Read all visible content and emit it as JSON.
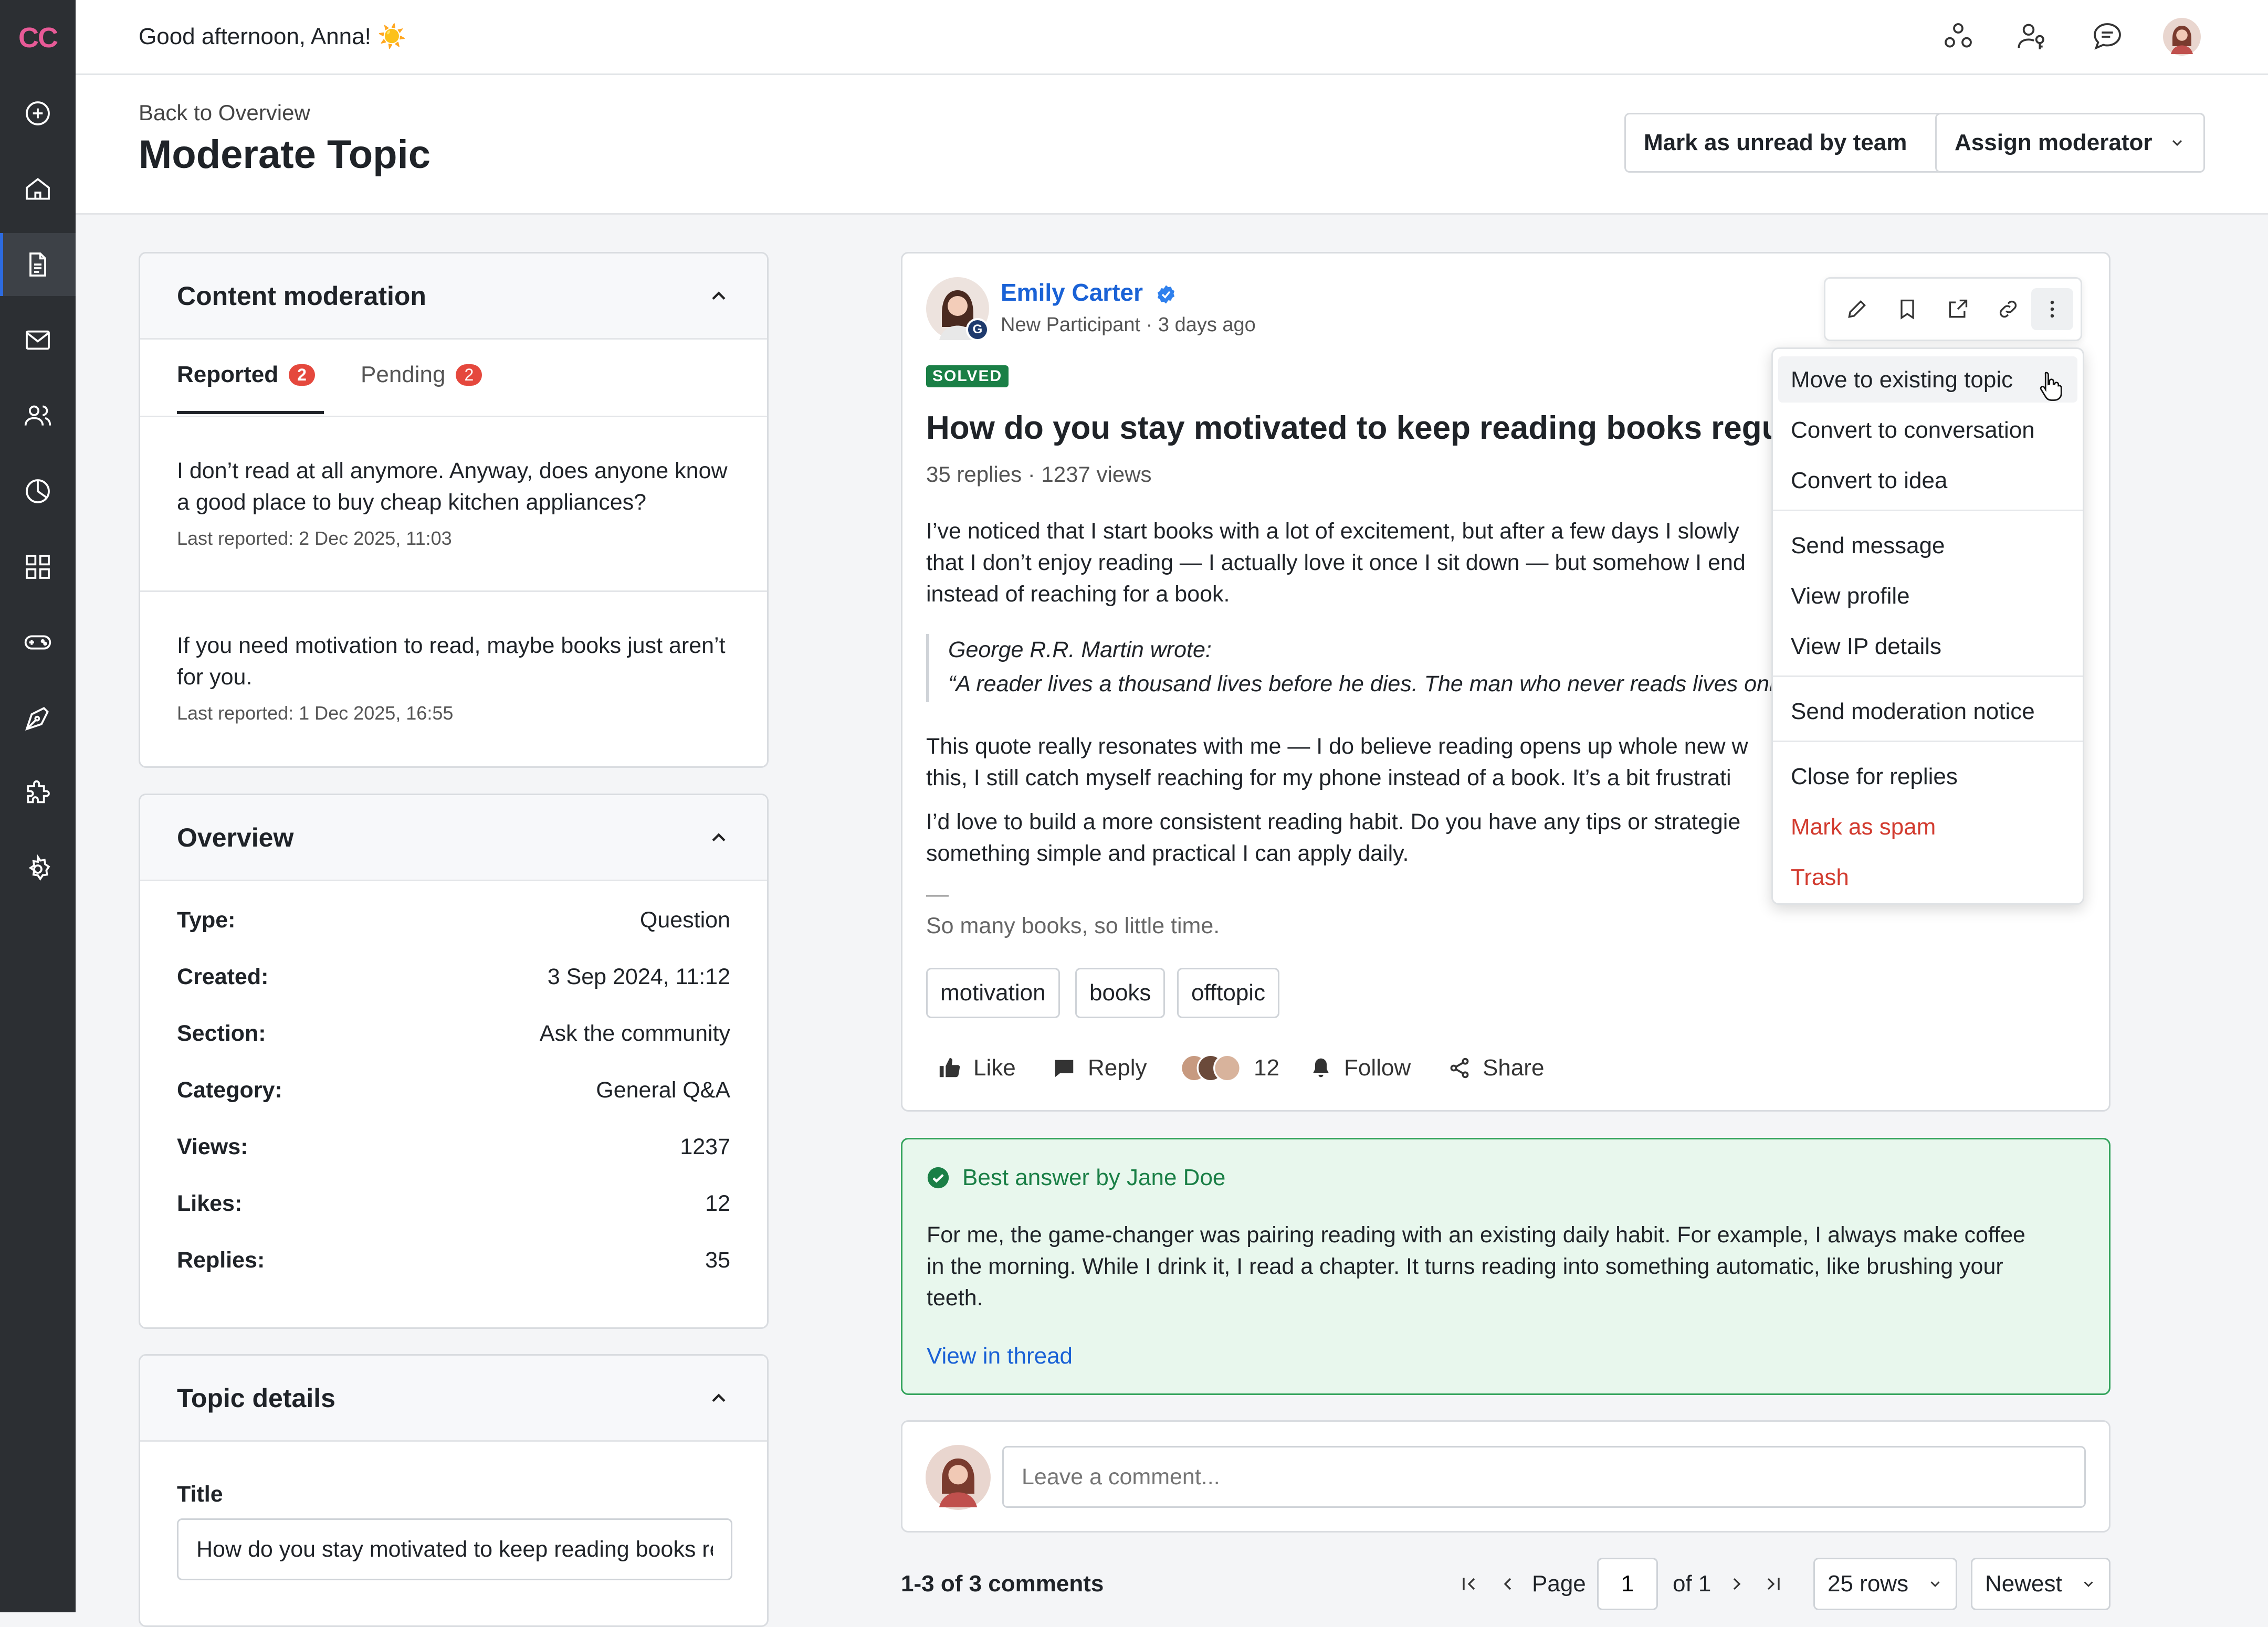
{
  "app": {
    "logo": "CC"
  },
  "sidebar": {
    "items": [
      {
        "icon": "add-icon"
      },
      {
        "icon": "home-icon"
      },
      {
        "icon": "document-icon",
        "active": true
      },
      {
        "icon": "mail-icon"
      },
      {
        "icon": "users-icon"
      },
      {
        "icon": "analytics-icon"
      },
      {
        "icon": "apps-grid-icon"
      },
      {
        "icon": "gamepad-icon"
      },
      {
        "icon": "design-pen-icon"
      },
      {
        "icon": "puzzle-icon"
      },
      {
        "icon": "settings-icon"
      }
    ]
  },
  "topbar": {
    "greeting": "Good afternoon, Anna! ☀️",
    "icons": [
      "community-icon",
      "user-key-icon",
      "chat-icon",
      "avatar"
    ]
  },
  "header": {
    "back_link": "Back to Overview",
    "title": "Moderate Topic",
    "mark_unread_label": "Mark as unread by team",
    "assign_label": "Assign moderator"
  },
  "content_moderation": {
    "title": "Content moderation",
    "tabs": [
      {
        "label": "Reported",
        "count": "2"
      },
      {
        "label": "Pending",
        "count": "2"
      }
    ],
    "reports": [
      {
        "text": "I don’t read at all anymore. Anyway, does anyone know a good place to buy cheap kitchen appliances?",
        "meta": "Last reported: 2 Dec 2025, 11:03"
      },
      {
        "text": "If you need motivation to read, maybe books just aren’t for you.",
        "meta": "Last reported: 1 Dec 2025, 16:55"
      }
    ]
  },
  "overview": {
    "title": "Overview",
    "rows": [
      {
        "k": "Type:",
        "v": "Question"
      },
      {
        "k": "Created:",
        "v": "3 Sep 2024, 11:12"
      },
      {
        "k": "Section:",
        "v": "Ask the community"
      },
      {
        "k": "Category:",
        "v": "General Q&A"
      },
      {
        "k": "Views:",
        "v": "1237"
      },
      {
        "k": "Likes:",
        "v": "12"
      },
      {
        "k": "Replies:",
        "v": "35"
      }
    ]
  },
  "topic_details": {
    "title": "Topic details",
    "title_label": "Title",
    "title_value": "How do you stay motivated to keep reading books regularly?"
  },
  "post": {
    "author": "Emily Carter",
    "author_role": "New Participant · 3 days ago",
    "status": "SOLVED",
    "title": "How do you stay motivated to keep reading books regu",
    "stats": "35 replies · 1237 views",
    "para1_l1": "I’ve noticed that I start books with a lot of excitement, but after a few days I slowly",
    "para1_l2": "that I don’t enjoy reading — I actually love it once I sit down — but somehow I end",
    "para1_l3": "instead of reaching for a book.",
    "quote_author": "George R.R. Martin wrote:",
    "quote_text": "“A reader lives a thousand lives before he dies. The man who never reads lives only o",
    "para2_l1": "This quote really resonates with me — I do believe reading opens up whole new w",
    "para2_l2": "this, I still catch myself reaching for my phone instead of a book. It’s a bit frustrati",
    "para3_l1": "I’d love to build a more consistent reading habit. Do you have any tips or strategie",
    "para3_l2": "something simple and practical I can apply daily.",
    "signature_sep": "—",
    "signature": "So many books, so little time.",
    "tags": [
      "motivation",
      "books",
      "offtopic"
    ],
    "actions": {
      "like": "Like",
      "reply": "Reply",
      "likers_count": "12",
      "follow": "Follow",
      "share": "Share"
    }
  },
  "toolbar_icons": [
    "edit-icon",
    "bookmark-icon",
    "open-external-icon",
    "link-icon",
    "more-vertical-icon"
  ],
  "menu": {
    "items": [
      {
        "label": "Move to existing topic",
        "hover": true
      },
      {
        "label": "Convert to conversation"
      },
      {
        "label": "Convert to idea"
      },
      {
        "label": "Send message"
      },
      {
        "label": "View profile"
      },
      {
        "label": "View IP details"
      },
      {
        "label": "Send moderation notice"
      },
      {
        "label": "Close for replies"
      },
      {
        "label": "Mark as spam",
        "danger": true
      },
      {
        "label": "Trash",
        "danger": true
      }
    ]
  },
  "best_answer": {
    "title": "Best answer by Jane Doe",
    "l1": "For me, the game-changer was pairing reading with an existing daily habit. For example, I always make coffee",
    "l2": "in the morning. While I drink it, I read a chapter. It turns reading into something automatic, like brushing your",
    "l3": "teeth.",
    "link": "View in thread"
  },
  "comment": {
    "placeholder": "Leave a comment..."
  },
  "pagination": {
    "summary": "1-3 of 3 comments",
    "page_label": "Page",
    "page_value": "1",
    "of_label": "of 1",
    "rows": "25 rows",
    "sort": "Newest"
  },
  "colors": {
    "accent": "#1a62d6",
    "success": "#1a7f46",
    "danger": "#d23b2f",
    "badge": "#e5483d",
    "sidebar": "#2c2f33"
  }
}
